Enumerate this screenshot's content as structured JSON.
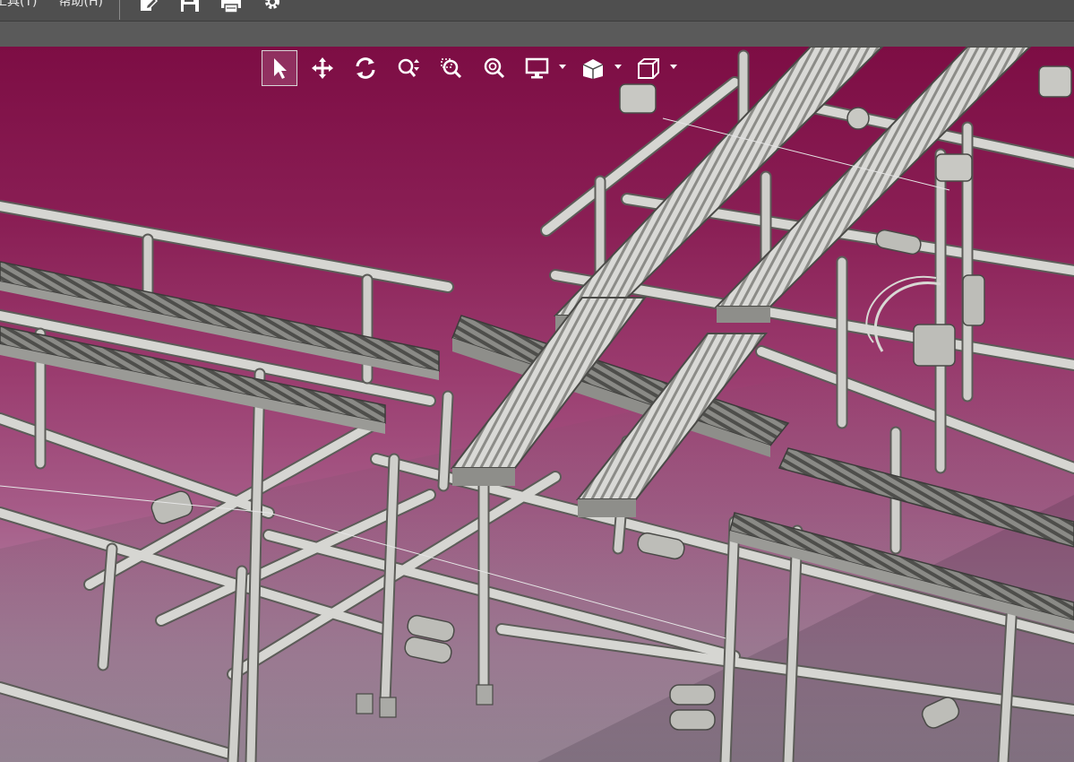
{
  "menubar": {
    "items": [
      {
        "label": "工具(T)"
      },
      {
        "label": "帮助(H)"
      }
    ],
    "quick_actions": [
      {
        "icon": "edit-document-icon"
      },
      {
        "icon": "save-icon"
      },
      {
        "icon": "print-icon"
      },
      {
        "icon": "settings-gear-icon"
      }
    ]
  },
  "viewport": {
    "background_top": "#7d0d44",
    "background_bottom": "#b8a3b4",
    "toolbar": [
      {
        "icon": "select-arrow-icon",
        "active": true
      },
      {
        "icon": "pan-move-icon"
      },
      {
        "icon": "rotate-icon"
      },
      {
        "icon": "zoom-in-out-icon"
      },
      {
        "icon": "zoom-window-icon"
      },
      {
        "icon": "zoom-fit-icon"
      },
      {
        "icon": "display-mode-icon",
        "dropdown": true
      },
      {
        "icon": "section-view-icon",
        "dropdown": true
      },
      {
        "icon": "view-cube-icon",
        "dropdown": true
      }
    ]
  }
}
